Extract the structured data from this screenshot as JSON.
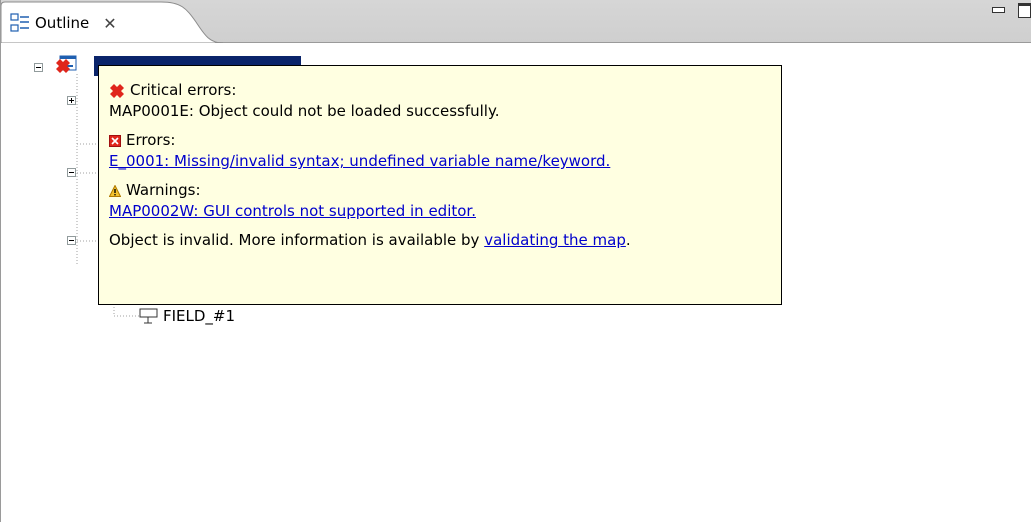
{
  "tab": {
    "title": "Outline",
    "close_glyph": "✕",
    "icon": "outline-icon"
  },
  "view_controls": {
    "minimize_icon": "minimize-icon",
    "maximize_icon": "maximize-icon"
  },
  "tree": {
    "visible_field_label": "FIELD_#1"
  },
  "tooltip": {
    "critical_heading": "Critical errors:",
    "critical_message": "MAP0001E: Object could not be loaded successfully.",
    "errors_heading": "Errors:",
    "errors_link": "E_0001: Missing/invalid syntax; undefined variable name/keyword.",
    "warnings_heading": "Warnings:",
    "warnings_link": "MAP0002W: GUI controls not supported in editor.",
    "footer_text": "Object is invalid. More information is available by ",
    "footer_link": "validating the map",
    "footer_end": "."
  },
  "colors": {
    "tooltip_bg": "#ffffe1",
    "link": "#0000cc",
    "selection": "#0a246a",
    "critical": "#e0261b",
    "warning": "#e8a317"
  }
}
